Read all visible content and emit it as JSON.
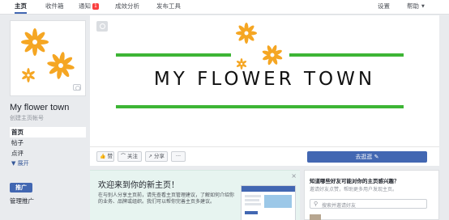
{
  "topnav": {
    "items": [
      {
        "label": "主页"
      },
      {
        "label": "收件箱"
      },
      {
        "label": "通知",
        "badge": "1"
      },
      {
        "label": "成效分析"
      },
      {
        "label": "发布工具"
      },
      {
        "label": "设置"
      },
      {
        "label": "帮助"
      }
    ]
  },
  "page": {
    "name": "My flower town",
    "handle": "创建主页帐号"
  },
  "leftnav": {
    "items": [
      {
        "label": "首页"
      },
      {
        "label": "帖子"
      },
      {
        "label": "点评"
      }
    ],
    "more": "▼ 展开"
  },
  "promote_label": "推广",
  "manage_label": "管理推广",
  "cover": {
    "title": "MY FLOWER TOWN",
    "bar_color": "#3db535",
    "flower_color": "#f5a623"
  },
  "actions": {
    "like": "赞",
    "follow": "关注",
    "share": "分享",
    "more": "···",
    "visit": "去逛逛"
  },
  "welcome": {
    "title": "欢迎来到你的新主页！",
    "body": "在与别人分享主页前，请先查看主页管理建议，了解如何介绍你的业务、品牌或组织。我们可以帮你完善主页多建议。",
    "close": "×"
  },
  "invite": {
    "title": "知道哪些好友可能对你的主页感兴趣？",
    "subtitle": "邀请好友点赞，帮助更多用户发现主页。",
    "search_placeholder": "搜索并邀请好友"
  },
  "colors": {
    "brand_blue": "#4267b2",
    "notification_red": "#fa3e3e"
  }
}
